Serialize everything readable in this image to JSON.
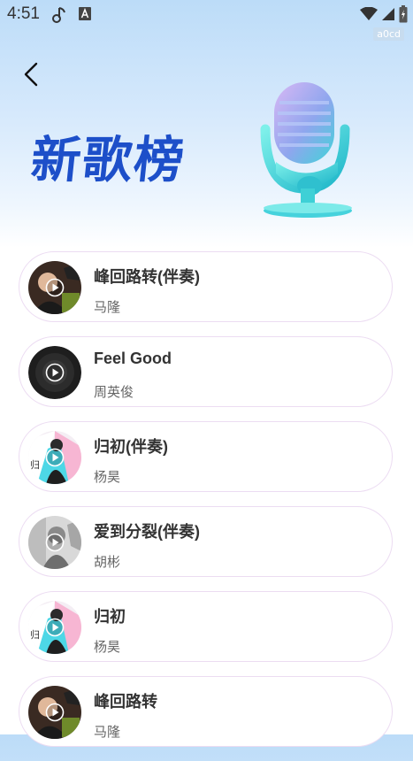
{
  "status_bar": {
    "time": "4:51",
    "debug_tag": "a0cd"
  },
  "header": {
    "title": "新歌榜"
  },
  "songs": [
    {
      "title": "峰回路转(伴奏)",
      "artist": "马隆",
      "cover": "portrait-dark"
    },
    {
      "title": "Feel Good",
      "artist": "周英俊",
      "cover": "vinyl-black"
    },
    {
      "title": "归初(伴奏)",
      "artist": "杨昊",
      "cover": "portrait-pink"
    },
    {
      "title": "爱到分裂(伴奏)",
      "artist": "胡彬",
      "cover": "portrait-gray"
    },
    {
      "title": "归初",
      "artist": "杨昊",
      "cover": "portrait-pink"
    },
    {
      "title": "峰回路转",
      "artist": "马隆",
      "cover": "portrait-dark"
    }
  ],
  "colors": {
    "title_blue": "#1d4fc9",
    "item_border": "#ecdcf2"
  }
}
